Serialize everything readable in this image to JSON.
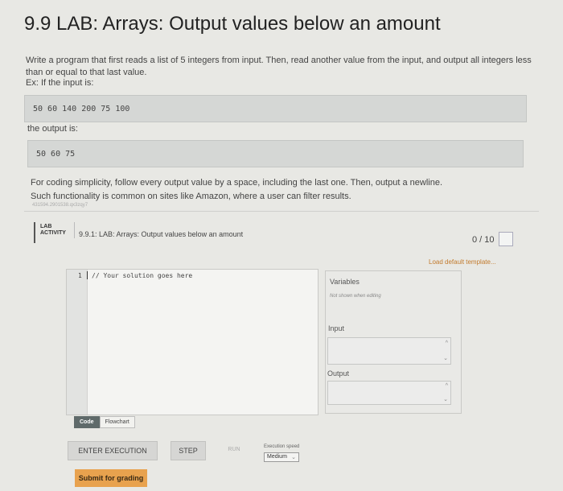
{
  "title": "9.9 LAB: Arrays: Output values below an amount",
  "intro": "Write a program that first reads a list of 5 integers from input. Then, read another value from the input, and output all integers less than or equal to that last value.",
  "example_label": "Ex: If the input is:",
  "example_input": "50 60 140 200 75 100",
  "output_label": "the output is:",
  "example_output": "50 60 75",
  "note1": "For coding simplicity, follow every output value by a space, including the last one. Then, output a newline.",
  "note2": "Such functionality is common on sites like Amazon, where a user can filter results.",
  "tracking_id": "431594.2901538.qx3zqy7",
  "lab": {
    "label_line1": "LAB",
    "label_line2": "ACTIVITY",
    "activity_title": "9.9.1: LAB: Arrays: Output values below an amount",
    "score": "0 / 10",
    "load_template": "Load default template..."
  },
  "editor": {
    "line_number": "1",
    "code": "// Your solution goes here"
  },
  "side": {
    "variables": "Variables",
    "not_shown": "Not shown when editing",
    "input": "Input",
    "output": "Output"
  },
  "tabs": {
    "code": "Code",
    "flowchart": "Flowchart"
  },
  "controls": {
    "enter_execution": "ENTER EXECUTION",
    "step": "STEP",
    "run": "RUN",
    "execution_speed": "Execution speed",
    "speed_value": "Medium"
  },
  "submit": "Submit for grading"
}
